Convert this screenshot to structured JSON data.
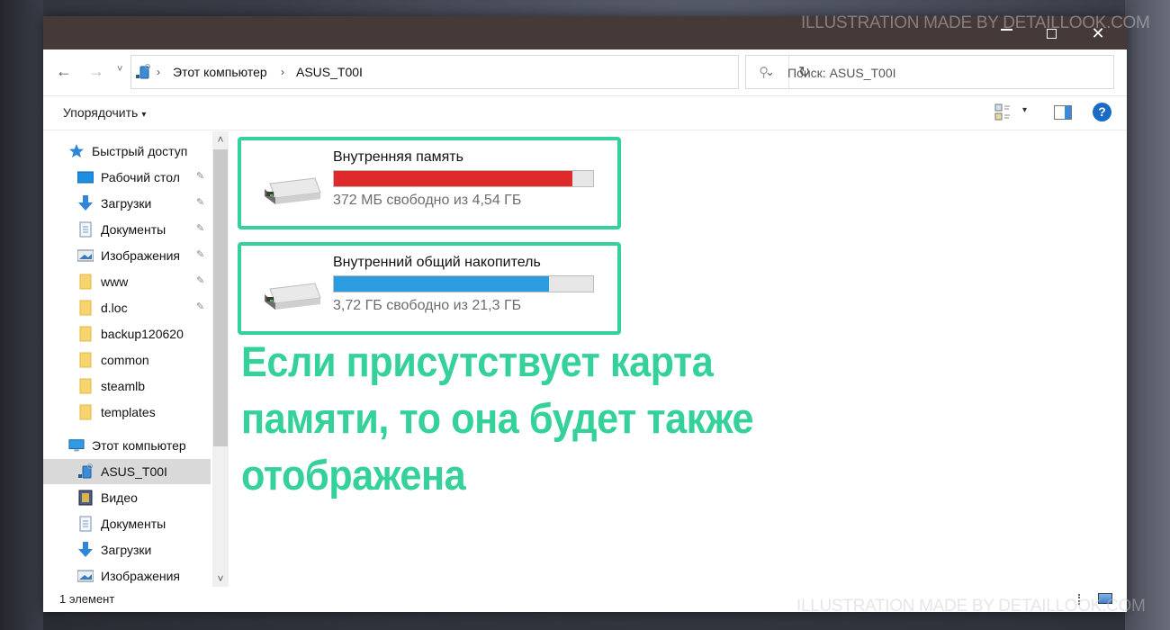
{
  "window": {
    "controls": {
      "minimize": "minimize",
      "maximize": "maximize",
      "close": "✕"
    }
  },
  "navigation": {
    "back_icon": "←",
    "forward_icon": "→",
    "recent_icon": "˅"
  },
  "address": {
    "breadcrumbs": [
      "Этот компьютер",
      "ASUS_T00I"
    ],
    "separator": "›",
    "dropdown_icon": "⌄",
    "refresh_icon": "↻"
  },
  "search": {
    "placeholder": "Поиск: ASUS_T00I",
    "icon": "⚲"
  },
  "toolbar": {
    "organize_label": "Упорядочить",
    "organize_caret": "▾",
    "view_caret": "▾",
    "help_label": "?"
  },
  "sidebar": {
    "scroll_up": "˄",
    "scroll_down": "˅",
    "pin_icon": "📌",
    "items": [
      {
        "label": "Быстрый доступ",
        "icon": "star-icon",
        "pinned": false
      },
      {
        "label": "Рабочий стол",
        "icon": "desktop-icon",
        "pinned": true
      },
      {
        "label": "Загрузки",
        "icon": "downloads-icon",
        "pinned": true
      },
      {
        "label": "Документы",
        "icon": "documents-icon",
        "pinned": true
      },
      {
        "label": "Изображения",
        "icon": "pictures-icon",
        "pinned": true
      },
      {
        "label": "www",
        "icon": "folder-icon",
        "pinned": true
      },
      {
        "label": "d.loc",
        "icon": "folder-icon",
        "pinned": true
      },
      {
        "label": "backup120620",
        "icon": "folder-icon",
        "pinned": false
      },
      {
        "label": "common",
        "icon": "folder-icon",
        "pinned": false
      },
      {
        "label": "steamlb",
        "icon": "folder-icon",
        "pinned": false
      },
      {
        "label": "templates",
        "icon": "folder-icon",
        "pinned": false
      },
      {
        "label": "Этот компьютер",
        "icon": "computer-icon",
        "pinned": false
      },
      {
        "label": "ASUS_T00I",
        "icon": "phone-device-icon",
        "pinned": false,
        "selected": true
      },
      {
        "label": "Видео",
        "icon": "video-icon",
        "pinned": false
      },
      {
        "label": "Документы",
        "icon": "documents-icon",
        "pinned": false
      },
      {
        "label": "Загрузки",
        "icon": "downloads-icon",
        "pinned": false
      },
      {
        "label": "Изображения",
        "icon": "pictures-icon",
        "pinned": false
      }
    ]
  },
  "drives": [
    {
      "name": "Внутренняя память",
      "free_text": "372 МБ свободно из 4,54 ГБ",
      "used_percent": 92,
      "bar_color": "#de2a2a"
    },
    {
      "name": "Внутренний общий накопитель",
      "free_text": "3,72 ГБ свободно из 21,3 ГБ",
      "used_percent": 83,
      "bar_color": "#2b9ce0"
    }
  ],
  "status": {
    "item_count": "1 элемент"
  },
  "annotation": {
    "text": "Если присутствует карта памяти, то она будет также отображена",
    "color": "#35d19b"
  },
  "watermark": {
    "text": "ILLUSTRATION MADE BY DETAILLOOK.COM"
  }
}
